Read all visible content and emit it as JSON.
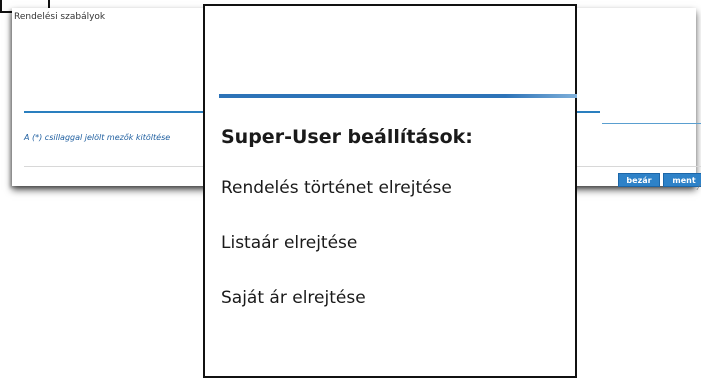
{
  "background_dialog": {
    "field_label": "Rendelési szabályok",
    "footnote": "A (*) csillaggal jelölt mezők kitöltése",
    "buttons": {
      "close_label": "bezár",
      "save_label": "ment"
    }
  },
  "popup": {
    "heading": "Super-User beállítások:",
    "items": [
      {
        "label": "Rendelés történet elrejtése"
      },
      {
        "label": "Listaár elrejtése"
      },
      {
        "label": "Saját ár elrejtése"
      }
    ]
  },
  "colors": {
    "accent_blue": "#2d73b8",
    "button_blue": "#2e82c8",
    "border": "#111111"
  }
}
